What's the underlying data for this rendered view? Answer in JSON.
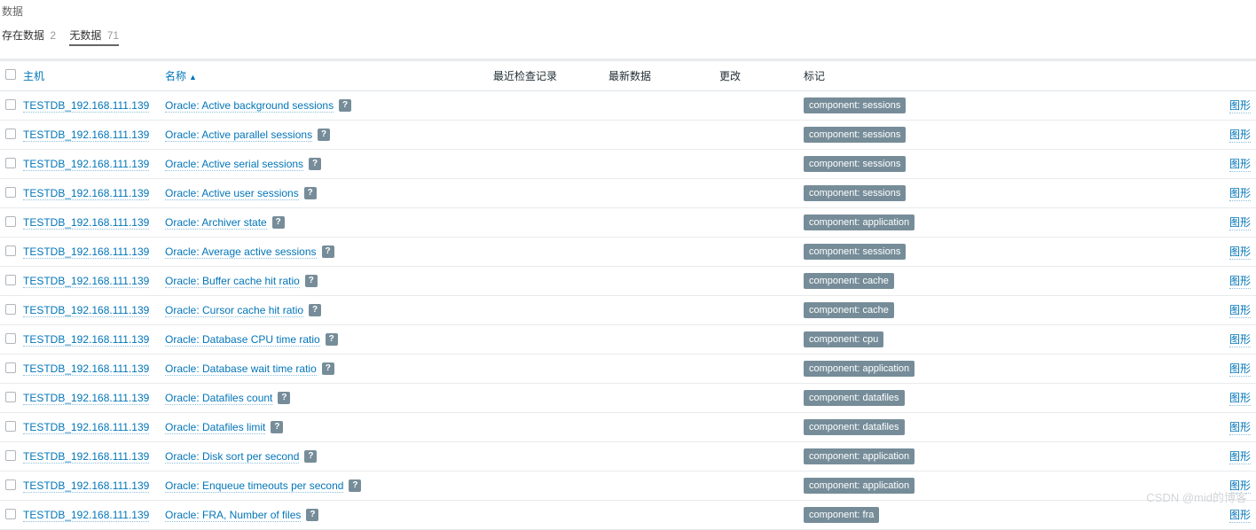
{
  "header": {
    "title": "数据",
    "tabs": [
      {
        "label": "存在数据",
        "count": "2"
      },
      {
        "label": "无数据",
        "count": "71"
      }
    ],
    "active_tab_index": 1
  },
  "table": {
    "columns": {
      "host": "主机",
      "name": "名称",
      "sort_indicator": "▲",
      "last_check": "最近检查记录",
      "latest": "最新数据",
      "change": "更改",
      "tags": "标记"
    },
    "graph_link_label": "图形",
    "help_icon_char": "?",
    "rows": [
      {
        "host": "TESTDB_192.168.111.139",
        "name": "Oracle: Active background sessions",
        "tag": "component: sessions"
      },
      {
        "host": "TESTDB_192.168.111.139",
        "name": "Oracle: Active parallel sessions",
        "tag": "component: sessions"
      },
      {
        "host": "TESTDB_192.168.111.139",
        "name": "Oracle: Active serial sessions",
        "tag": "component: sessions"
      },
      {
        "host": "TESTDB_192.168.111.139",
        "name": "Oracle: Active user sessions",
        "tag": "component: sessions"
      },
      {
        "host": "TESTDB_192.168.111.139",
        "name": "Oracle: Archiver state",
        "tag": "component: application"
      },
      {
        "host": "TESTDB_192.168.111.139",
        "name": "Oracle: Average active sessions",
        "tag": "component: sessions"
      },
      {
        "host": "TESTDB_192.168.111.139",
        "name": "Oracle: Buffer cache hit ratio",
        "tag": "component: cache"
      },
      {
        "host": "TESTDB_192.168.111.139",
        "name": "Oracle: Cursor cache hit ratio",
        "tag": "component: cache"
      },
      {
        "host": "TESTDB_192.168.111.139",
        "name": "Oracle: Database CPU time ratio",
        "tag": "component: cpu"
      },
      {
        "host": "TESTDB_192.168.111.139",
        "name": "Oracle: Database wait time ratio",
        "tag": "component: application"
      },
      {
        "host": "TESTDB_192.168.111.139",
        "name": "Oracle: Datafiles count",
        "tag": "component: datafiles"
      },
      {
        "host": "TESTDB_192.168.111.139",
        "name": "Oracle: Datafiles limit",
        "tag": "component: datafiles"
      },
      {
        "host": "TESTDB_192.168.111.139",
        "name": "Oracle: Disk sort per second",
        "tag": "component: application"
      },
      {
        "host": "TESTDB_192.168.111.139",
        "name": "Oracle: Enqueue timeouts per second",
        "tag": "component: application"
      },
      {
        "host": "TESTDB_192.168.111.139",
        "name": "Oracle: FRA, Number of files",
        "tag": "component: fra"
      }
    ]
  },
  "watermark": "CSDN @mid的博客"
}
